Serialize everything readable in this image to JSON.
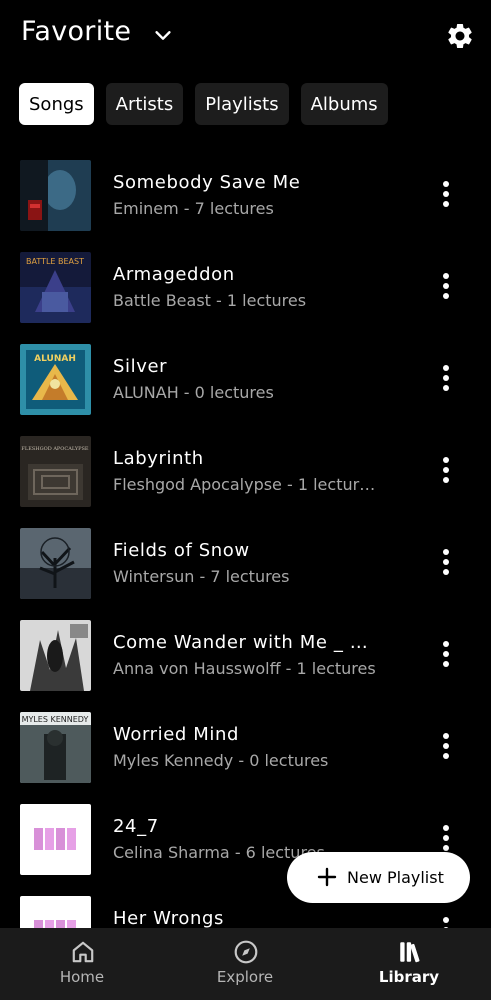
{
  "header": {
    "title": "Favorite"
  },
  "chips": [
    "Songs",
    "Artists",
    "Playlists",
    "Albums"
  ],
  "songs": [
    {
      "title": "Somebody Save Me",
      "subtitle": "Eminem - 7 lectures"
    },
    {
      "title": "Armageddon",
      "subtitle": "Battle Beast - 1 lectures"
    },
    {
      "title": "Silver",
      "subtitle": "ALUNAH - 0 lectures"
    },
    {
      "title": "Labyrinth",
      "subtitle": "Fleshgod Apocalypse - 1 lectur…"
    },
    {
      "title": "Fields of Snow",
      "subtitle": "Wintersun - 7 lectures"
    },
    {
      "title": "Come Wander with Me _ …",
      "subtitle": "Anna von Hausswolff - 1 lectures"
    },
    {
      "title": "Worried Mind",
      "subtitle": "Myles Kennedy - 0 lectures"
    },
    {
      "title": "24_7",
      "subtitle": "Celina Sharma - 6 lectures"
    },
    {
      "title": "Her Wrongs",
      "subtitle": ""
    }
  ],
  "album_art_text": {
    "armageddon": "BATTLE BEAST",
    "silver": "ALUNAH",
    "labyrinth": "FLESHGOD APOCALYPSE",
    "worried_mind": "MYLES KENNEDY"
  },
  "fab": {
    "label": "New Playlist"
  },
  "nav": {
    "home": "Home",
    "explore": "Explore",
    "library": "Library"
  },
  "colors": {
    "background": "#000000",
    "nav_background": "#1b1b1b",
    "chip_background": "#1d1d1d",
    "secondary_text": "#a8a8a8"
  }
}
